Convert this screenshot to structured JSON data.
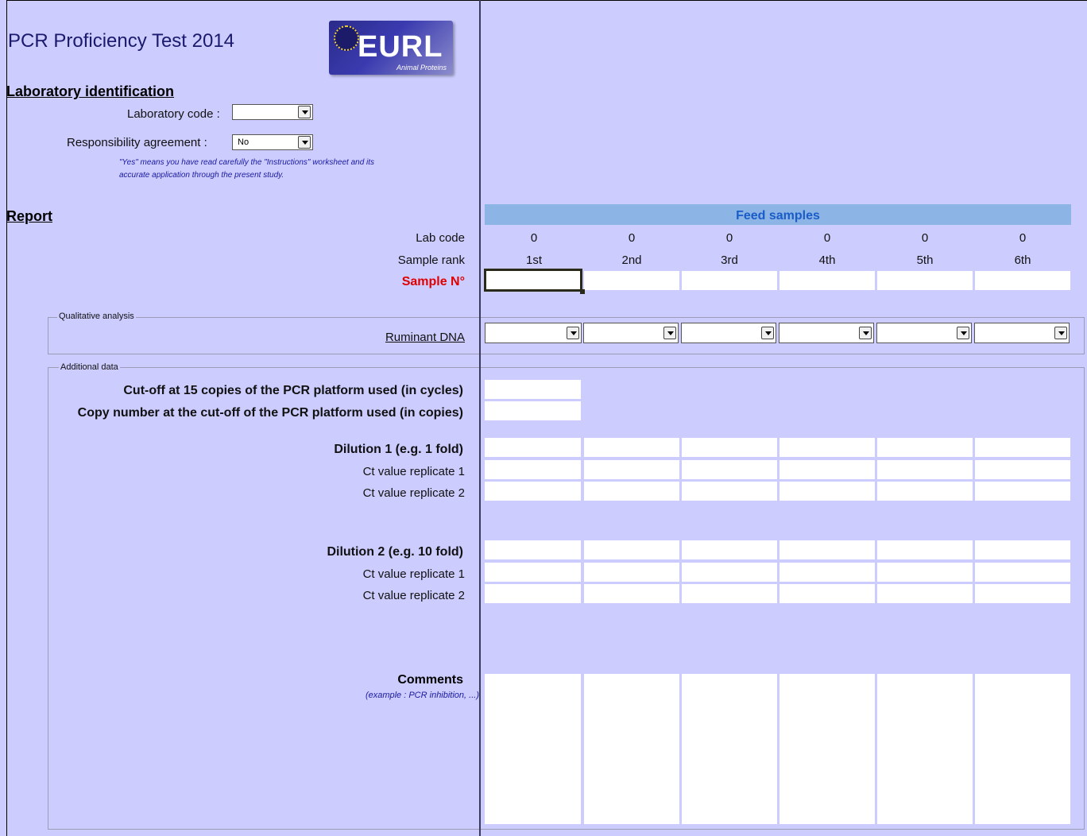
{
  "title": "PCR Proficiency Test 2014",
  "logo": {
    "text": "EURL",
    "subtitle": "Animal Proteins"
  },
  "lab_identification": {
    "heading": "Laboratory identification",
    "lab_code_label": "Laboratory code :",
    "lab_code_value": "",
    "agreement_label": "Responsibility  agreement :",
    "agreement_value": "No",
    "note_line1": "\"Yes\" means you have read carefully the \"Instructions\" worksheet and its",
    "note_line2": "accurate application through the present study."
  },
  "report": {
    "heading": "Report",
    "banner": "Feed samples",
    "lab_code_label": "Lab code",
    "sample_rank_label": "Sample rank",
    "sample_n_label": "Sample N°",
    "columns": [
      {
        "lab_code": "0",
        "rank": "1st"
      },
      {
        "lab_code": "0",
        "rank": "2nd"
      },
      {
        "lab_code": "0",
        "rank": "3rd"
      },
      {
        "lab_code": "0",
        "rank": "4th"
      },
      {
        "lab_code": "0",
        "rank": "5th"
      },
      {
        "lab_code": "0",
        "rank": "6th"
      }
    ]
  },
  "qualitative": {
    "group_label": "Qualitative analysis",
    "ruminant_label": "Ruminant DNA"
  },
  "additional": {
    "group_label": "Additional data",
    "cutoff_label": "Cut-off at 15 copies of the PCR platform used (in cycles)",
    "copy_label": "Copy number at the cut-off of the PCR platform used (in copies)",
    "dilution1_label": "Dilution 1 (e.g. 1 fold)",
    "dilution2_label": "Dilution 2 (e.g. 10 fold)",
    "ct1_label": "Ct value replicate 1",
    "ct2_label": "Ct value replicate 2",
    "comments_label": "Comments",
    "comments_note": "(example  : PCR inhibition, ...)"
  },
  "colors": {
    "sheet_bg": "#ccccff",
    "banner_bg": "#8cb4e4",
    "banner_text": "#1a5dc8",
    "sample_label": "#e00000"
  }
}
